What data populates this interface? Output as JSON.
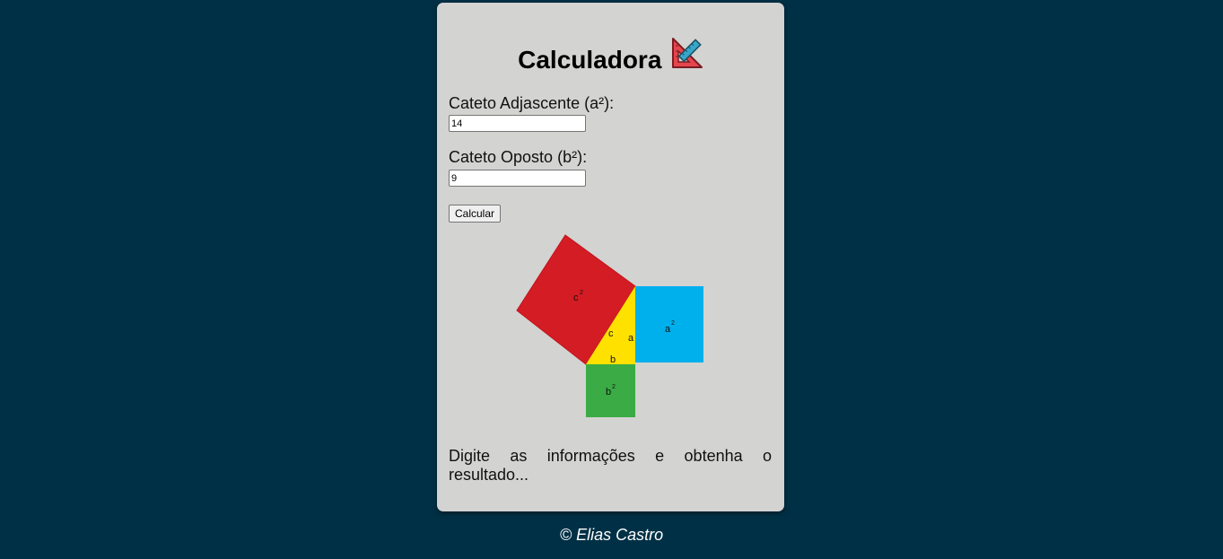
{
  "header": {
    "title": "Calculadora",
    "icon": "triangle-ruler-icon"
  },
  "form": {
    "cateto_adjacente": {
      "label": "Cateto Adjascente (a²):",
      "value": "14"
    },
    "cateto_oposto": {
      "label": "Cateto Oposto (b²):",
      "value": "9"
    },
    "calcular_label": "Calcular"
  },
  "diagram": {
    "square_c_label": "c",
    "square_a_label": "a",
    "square_b_label": "b",
    "side_c": "c",
    "side_a": "a",
    "side_b": "b",
    "superscript": "2",
    "colors": {
      "c_square": "#d41c24",
      "a_square": "#00b0ec",
      "b_square": "#3aab45",
      "triangle": "#ffe100"
    }
  },
  "result": {
    "words_line1": [
      "Digite",
      "as",
      "informações",
      "e",
      "obtenha",
      "o"
    ],
    "line2": "resultado..."
  },
  "footer": {
    "text": "© Elias Castro"
  }
}
